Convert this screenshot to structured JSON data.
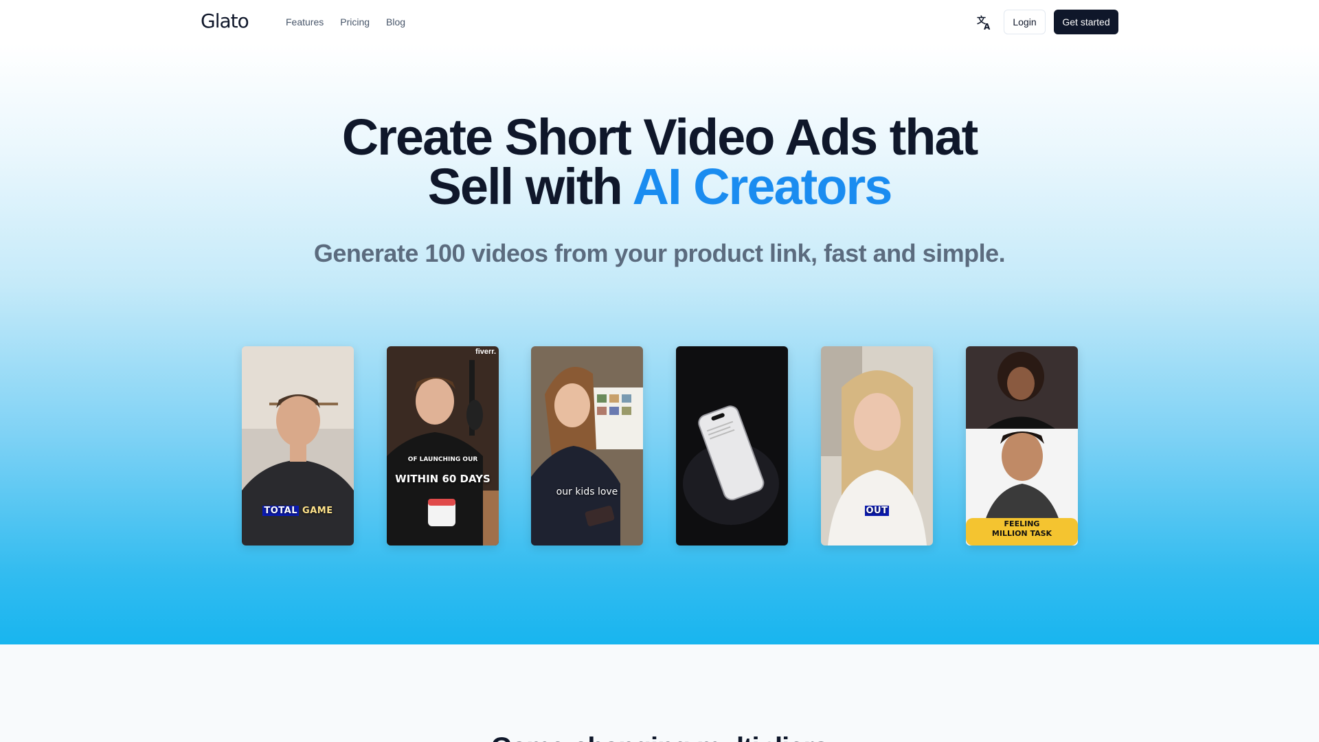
{
  "nav": {
    "logo": "Glato",
    "links": [
      "Features",
      "Pricing",
      "Blog"
    ],
    "login_label": "Login",
    "cta_label": "Get started",
    "translate_icon": "translate-icon"
  },
  "hero": {
    "title_line1": "Create Short Video Ads that",
    "title_line2_plain": "Sell with ",
    "title_line2_accent": "AI Creators",
    "subtitle": "Generate 100 videos from your product link, fast and simple.",
    "accent_color": "#1a8cf0"
  },
  "videos": [
    {
      "caption_hl": "TOTAL",
      "caption_rest": "GAME"
    },
    {
      "watermark": "fiverr.",
      "caption_small": "OF LAUNCHING OUR",
      "caption_big": "WITHIN 60 DAYS"
    },
    {
      "caption": "our kids love"
    },
    {},
    {
      "caption_hl": "OUT"
    },
    {
      "caption_top": "FEELING",
      "caption_bottom": "MILLION TASK"
    }
  ],
  "section2": {
    "title": "Game-changing multipliers"
  },
  "colors": {
    "primary_dark": "#0f172a",
    "hero_bottom": "#18b5ef"
  }
}
